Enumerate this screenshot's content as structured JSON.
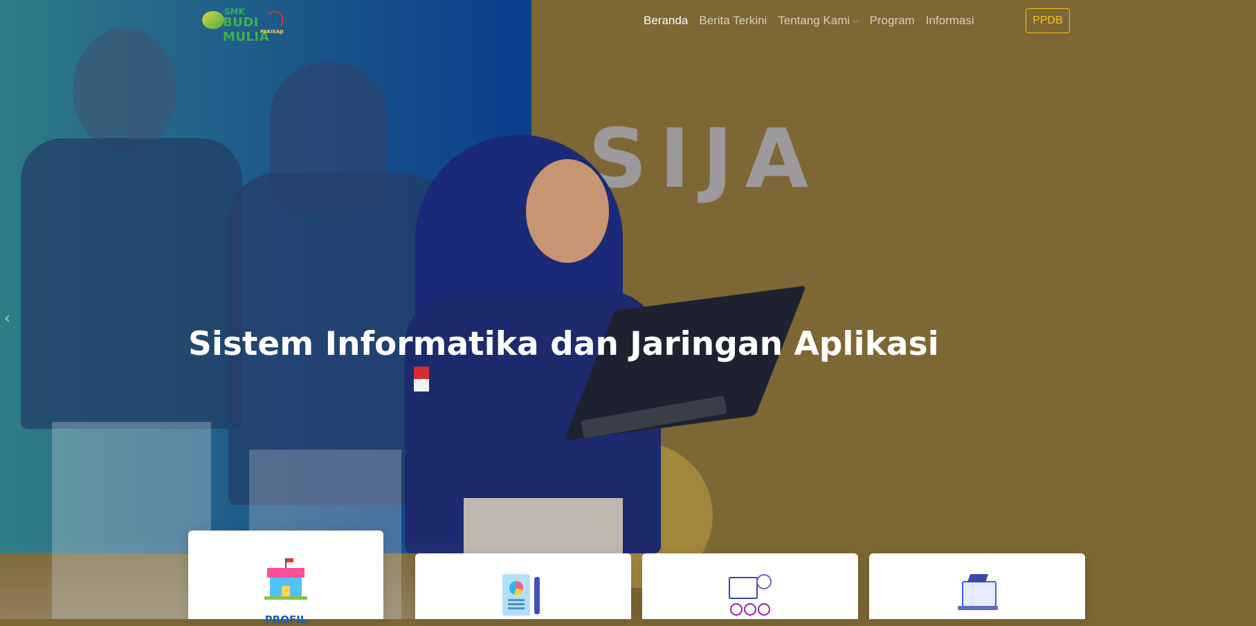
{
  "navbar": {
    "logo": {
      "line1": "SMK",
      "line2": "BUDI MULIA",
      "line3": "PAKISAJI"
    },
    "links": [
      {
        "label": "Beranda",
        "active": true
      },
      {
        "label": "Berita Terkini",
        "active": false
      },
      {
        "label": "Tentang Kami",
        "active": false,
        "dropdown": true
      },
      {
        "label": "Program",
        "active": false
      },
      {
        "label": "Informasi",
        "active": false
      }
    ],
    "cta_label": "PPDB"
  },
  "hero": {
    "ghost_text": "SIJA",
    "title": "Sistem Informatika dan Jaringan Aplikasi",
    "prev_arrow": "‹"
  },
  "cards": [
    {
      "label": "PROFIL",
      "icon": "school-building-icon"
    },
    {
      "label": "",
      "icon": "report-document-icon"
    },
    {
      "label": "",
      "icon": "presentation-icon"
    },
    {
      "label": "",
      "icon": "online-learning-icon"
    }
  ],
  "colors": {
    "accent": "#f5c518",
    "left_panel": "#0b3d8c",
    "right_panel": "#7d6734",
    "card_label": "#1b5fae"
  }
}
